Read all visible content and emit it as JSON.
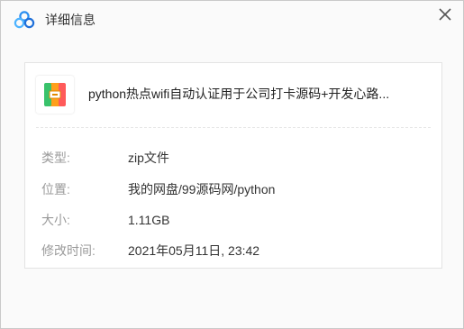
{
  "window": {
    "title": "详细信息"
  },
  "file": {
    "name": "python热点wifi自动认证用于公司打卡源码+开发心路...",
    "icon": "zip-archive-icon"
  },
  "details": [
    {
      "label": "类型:",
      "value": "zip文件"
    },
    {
      "label": "位置:",
      "value": "我的网盘/99源码网/python"
    },
    {
      "label": "大小:",
      "value": "1.11GB"
    },
    {
      "label": "修改时间:",
      "value": "2021年05月11日, 23:42"
    }
  ],
  "colors": {
    "brand_blue": "#2a8ef0",
    "label_gray": "#9a9a9a",
    "value_text": "#333333"
  }
}
